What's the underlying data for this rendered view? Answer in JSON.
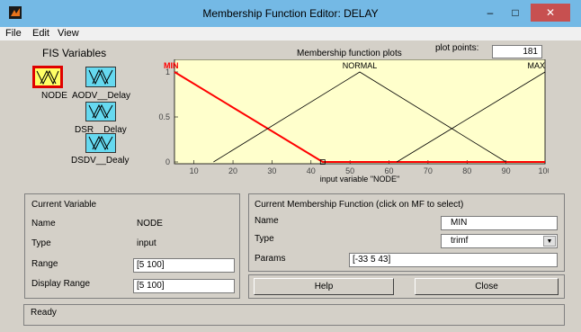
{
  "window": {
    "title": "Membership Function Editor: DELAY",
    "controls": {
      "minimize": "–",
      "maximize": "□",
      "close": "✕"
    }
  },
  "menu": [
    "File",
    "Edit",
    "View"
  ],
  "fis_variables": {
    "heading": "FIS Variables",
    "input_label": "NODE",
    "outputs": [
      "AODV__Delay",
      "DSR__Delay",
      "DSDV__Dealy"
    ]
  },
  "plot": {
    "header_label": "Membership function plots",
    "plot_points_label": "plot points:",
    "plot_points_value": "181",
    "xlabel": "input variable \"NODE\"",
    "x_ticks": [
      "10",
      "20",
      "30",
      "40",
      "50",
      "60",
      "70",
      "80",
      "90",
      "100"
    ],
    "y_ticks": [
      "1",
      "0.5",
      "0"
    ],
    "mf_names": [
      "MIN",
      "NORMAL",
      "MAX"
    ],
    "selected_color": "#ff0000",
    "line_color": "#000000",
    "background": "#ffffcc"
  },
  "chart_data": {
    "type": "line",
    "xlim": [
      5,
      100
    ],
    "ylim": [
      0,
      1
    ],
    "series": [
      {
        "name": "MIN",
        "x": [
          5,
          43,
          100
        ],
        "y": [
          1,
          0,
          0
        ]
      },
      {
        "name": "NORMAL",
        "x": [
          15,
          52.5,
          90
        ],
        "y": [
          0,
          1,
          0
        ]
      },
      {
        "name": "MAX",
        "x": [
          62,
          100
        ],
        "y": [
          0,
          1
        ]
      }
    ],
    "xlabel": "input variable \"NODE\""
  },
  "current_variable": {
    "heading": "Current Variable",
    "name_label": "Name",
    "name_value": "NODE",
    "type_label": "Type",
    "type_value": "input",
    "range_label": "Range",
    "range_value": "[5 100]",
    "display_range_label": "Display Range",
    "display_range_value": "[5 100]"
  },
  "current_mf": {
    "heading": "Current Membership Function (click on MF to select)",
    "name_label": "Name",
    "name_value": "MIN",
    "type_label": "Type",
    "type_value": "trimf",
    "params_label": "Params",
    "params_value": "[-33 5 43]"
  },
  "buttons": {
    "help": "Help",
    "close": "Close"
  },
  "status": "Ready"
}
